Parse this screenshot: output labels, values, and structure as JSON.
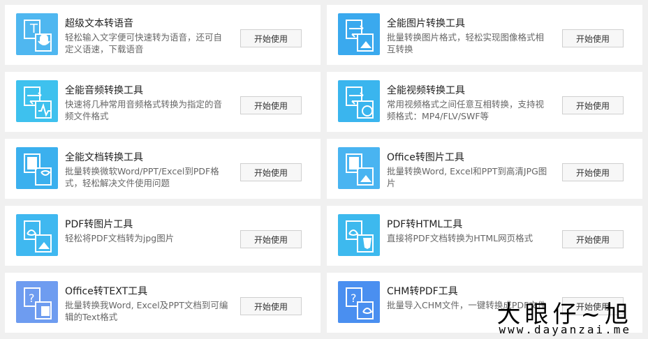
{
  "button_label": "开始使用",
  "tools": [
    {
      "title": "超级文本转语音",
      "desc": "轻松输入文字便可快速转为语音，还可自定义语速，下载语音",
      "icon": "text-to-speech-icon",
      "color": "#4fb7f0"
    },
    {
      "title": "全能图片转换工具",
      "desc": "批量转换图片格式，轻松实现图像格式相互转换",
      "icon": "image-convert-icon",
      "color": "#3aa9ee"
    },
    {
      "title": "全能音频转换工具",
      "desc": "快速将几种常用音频格式转换为指定的音频文件格式",
      "icon": "audio-convert-icon",
      "color": "#3ec1ee"
    },
    {
      "title": "全能视频转换工具",
      "desc": "常用视频格式之间任意互相转换，支持视频格式：MP4/FLV/SWF等",
      "icon": "video-convert-icon",
      "color": "#3ab5ee"
    },
    {
      "title": "全能文档转换工具",
      "desc": "批量转换微软Word/PPT/Excel到PDF格式，轻松解决文件使用问题",
      "icon": "document-convert-icon",
      "color": "#3bb0ee"
    },
    {
      "title": "Office转图片工具",
      "desc": "批量转换Word, Excel和PPT到高清JPG图片",
      "icon": "office-to-image-icon",
      "color": "#49b4f1"
    },
    {
      "title": "PDF转图片工具",
      "desc": "轻松将PDF文档转为jpg图片",
      "icon": "pdf-to-image-icon",
      "color": "#3fb8f0"
    },
    {
      "title": "PDF转HTML工具",
      "desc": "直接将PDF文档转换为HTML网页格式",
      "icon": "pdf-to-html-icon",
      "color": "#3db9ee"
    },
    {
      "title": "Office转TEXT工具",
      "desc": "批量转换我Word, Excel及PPT文档到可编辑的Text格式",
      "icon": "office-to-text-icon",
      "color": "#6e9cf0"
    },
    {
      "title": "CHM转PDF工具",
      "desc": "批量导入CHM文件，一键转换成PDF文件",
      "icon": "chm-to-pdf-icon",
      "color": "#4a8ff0"
    }
  ],
  "watermark": {
    "line1": "大眼仔~旭",
    "line2": "www.dayanzai.me"
  }
}
